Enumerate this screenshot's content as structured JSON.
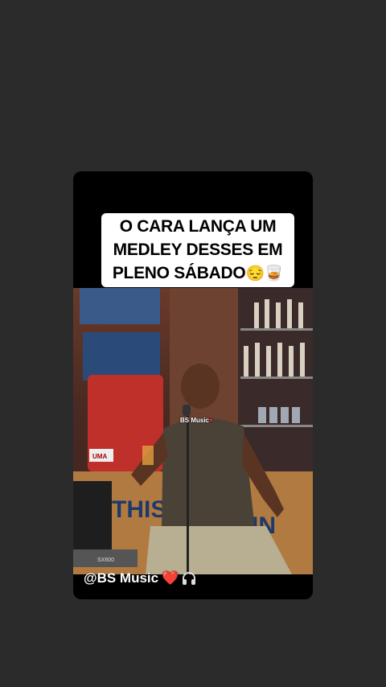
{
  "caption": {
    "line1": "O CARA LANÇA UM",
    "line2": "MEDLEY DESSES EM",
    "line3": "PLENO SÁBADO",
    "emojis": "😔🥃"
  },
  "video": {
    "watermark": "BS Music",
    "backdrop_text": "THIS",
    "backdrop_text_right": "IN",
    "sign_text": "UMA",
    "keyboard_label": "SX600"
  },
  "credit": {
    "handle": "@BS Music",
    "heart": "❤️",
    "icon": "headphones-icon"
  },
  "colors": {
    "background": "#2b2b2b",
    "card": "#000000",
    "caption_bg": "#ffffff",
    "heart": "#e8243b"
  }
}
